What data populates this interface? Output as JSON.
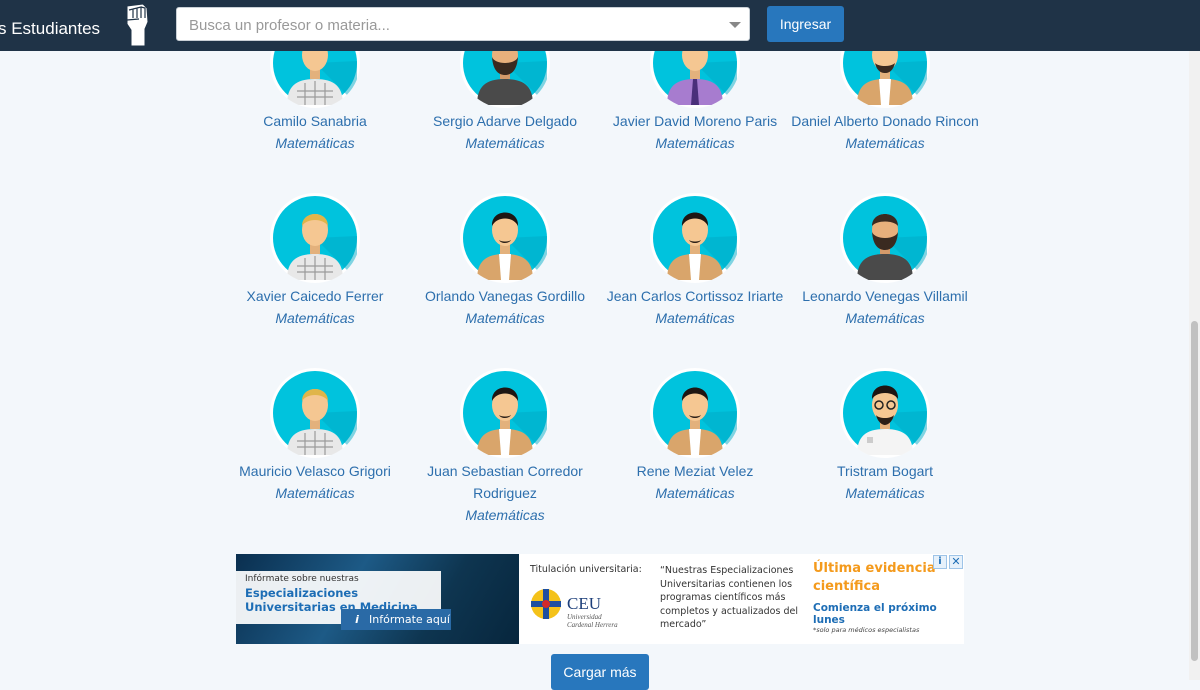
{
  "header": {
    "brand": "s Estudiantes",
    "brand_icon": "raised-fist-icon",
    "search_placeholder": "Busca un profesor o materia...",
    "login_label": "Ingresar"
  },
  "colors": {
    "navbar": "#1f3347",
    "primary_button": "#2877bd",
    "link": "#2d6fad",
    "avatar_bg": "#00c3dd",
    "ad_orange": "#f49a1c"
  },
  "teachers": [
    {
      "name": "Camilo Sanabria",
      "subject": "Matemáticas",
      "avatar": "plaid-shirt-man-avatar"
    },
    {
      "name": "Sergio Adarve Delgado",
      "subject": "Matemáticas",
      "avatar": "bearded-man-dark-shirt-avatar"
    },
    {
      "name": "Javier David Moreno Paris",
      "subject": "Matemáticas",
      "avatar": "man-purple-shirt-tie-avatar"
    },
    {
      "name": "Daniel Alberto Donado Rincon",
      "subject": "Matemáticas",
      "avatar": "bearded-man-jacket-avatar"
    },
    {
      "name": "Xavier Caicedo Ferrer",
      "subject": "Matemáticas",
      "avatar": "blond-man-plaid-shirt-avatar"
    },
    {
      "name": "Orlando Vanegas Gordillo",
      "subject": "Matemáticas",
      "avatar": "man-jacket-avatar"
    },
    {
      "name": "Jean Carlos Cortissoz Iriarte",
      "subject": "Matemáticas",
      "avatar": "man-jacket-avatar"
    },
    {
      "name": "Leonardo Venegas Villamil",
      "subject": "Matemáticas",
      "avatar": "bearded-man-dark-shirt-avatar"
    },
    {
      "name": "Mauricio Velasco Grigori",
      "subject": "Matemáticas",
      "avatar": "blond-man-plaid-shirt-avatar"
    },
    {
      "name": "Juan Sebastian Corredor Rodriguez",
      "subject": "Matemáticas",
      "avatar": "man-jacket-avatar"
    },
    {
      "name": "Rene Meziat Velez",
      "subject": "Matemáticas",
      "avatar": "man-jacket-avatar"
    },
    {
      "name": "Tristram Bogart",
      "subject": "Matemáticas",
      "avatar": "man-glasses-white-coat-avatar"
    }
  ],
  "ad": {
    "intro": "Infórmate sobre nuestras",
    "headline": "Especializaciones Universitarias en Medicina",
    "info_button": "Infórmate aquí",
    "titulacion": "Titulación universitaria:",
    "logo_text": "CEU",
    "logo_sub": "Universidad Cardenal Herrera",
    "quote": "“Nuestras Especializaciones Universitarias contienen los programas científicos más completos y actualizados del mercado”",
    "orange": "Última evidencia científica",
    "blue": "Comienza el próximo lunes",
    "note": "*solo para médicos especialistas",
    "adchoices_icon": "info-icon",
    "close_icon": "close-icon"
  },
  "load_more_label": "Cargar más"
}
